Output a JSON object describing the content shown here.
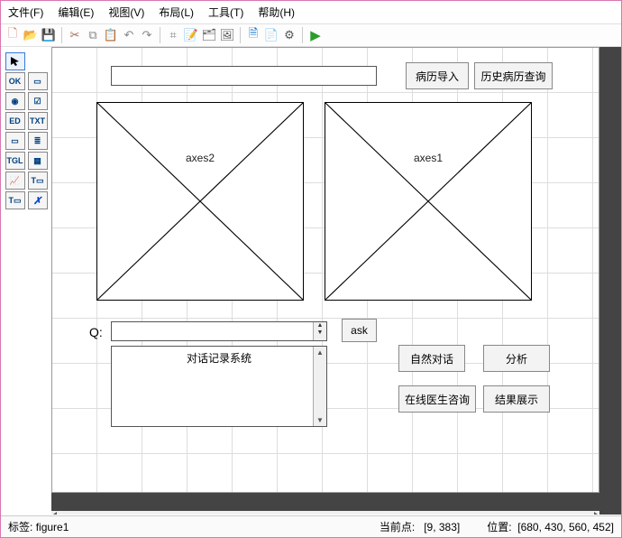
{
  "menu": {
    "file": "文件(F)",
    "edit": "编辑(E)",
    "view": "视图(V)",
    "layout": "布局(L)",
    "tools": "工具(T)",
    "help": "帮助(H)"
  },
  "buttons": {
    "import": "病历导入",
    "history_query": "历史病历查询",
    "ask": "ask",
    "natural_dialog": "自然对话",
    "analysis": "分析",
    "doctor_consult": "在线医生咨询",
    "result_display": "结果展示"
  },
  "axes": {
    "a1": "axes1",
    "a2": "axes2"
  },
  "q_label": "Q:",
  "listbox_text": "对话记录系统",
  "status": {
    "tag_label": "标签:",
    "tag_value": "figure1",
    "curpoint_label": "当前点:",
    "curpoint_value": "[9, 383]",
    "pos_label": "位置:",
    "pos_value": "[680, 430, 560, 452]"
  }
}
